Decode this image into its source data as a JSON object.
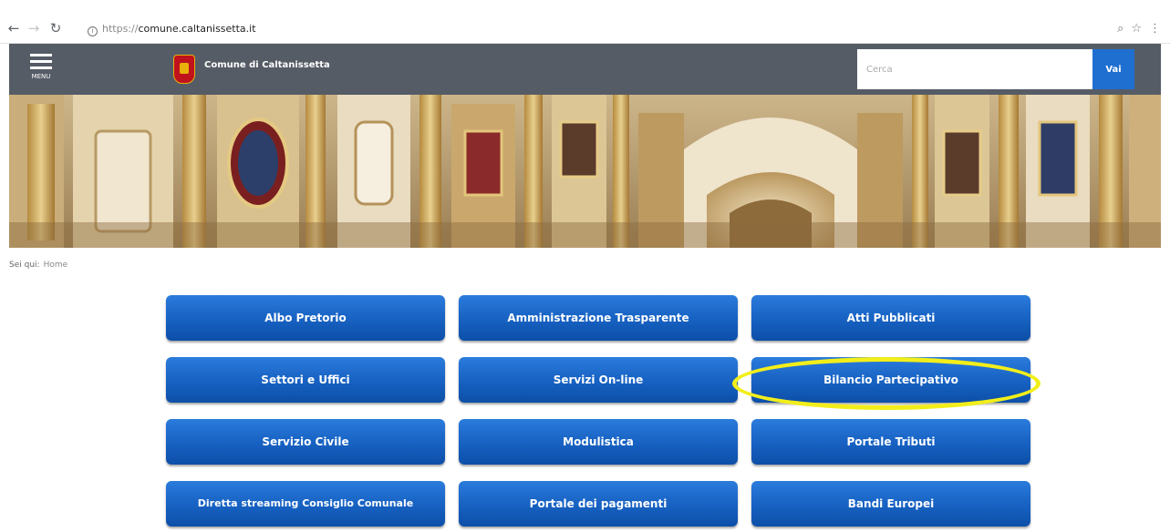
{
  "browser": {
    "back_icon": "back-arrow-icon",
    "forward_icon": "forward-arrow-icon",
    "reload_icon": "reload-icon",
    "url_scheme": "https://",
    "url_host": "comune.caltanissetta.it",
    "zoom_icon": "zoom-icon",
    "star_icon": "star-icon",
    "more_icon": "more-icon"
  },
  "header": {
    "menu_label": "MENU",
    "site_title": "Comune di Caltanissetta",
    "search_placeholder": "Cerca",
    "search_button": "Vai",
    "colors": {
      "bar": "#555c66",
      "search_button": "#1f6fd0",
      "logo": "#c0121c"
    }
  },
  "breadcrumb": {
    "prefix": "Sei qui:",
    "items": [
      "Home"
    ]
  },
  "grid": {
    "buttons": [
      "Albo Pretorio",
      "Amministrazione Trasparente",
      "Atti Pubblicati",
      "Settori e Uffici",
      "Servizi On-line",
      "Bilancio Partecipativo",
      "Servizio Civile",
      "Modulistica",
      "Portale Tributi",
      "Diretta streaming Consiglio Comunale",
      "Portale dei pagamenti",
      "Bandi Europei"
    ],
    "highlighted": "Bilancio Partecipativo",
    "colors": {
      "button": "#1863c4",
      "highlight": "#f2ee1a"
    }
  }
}
